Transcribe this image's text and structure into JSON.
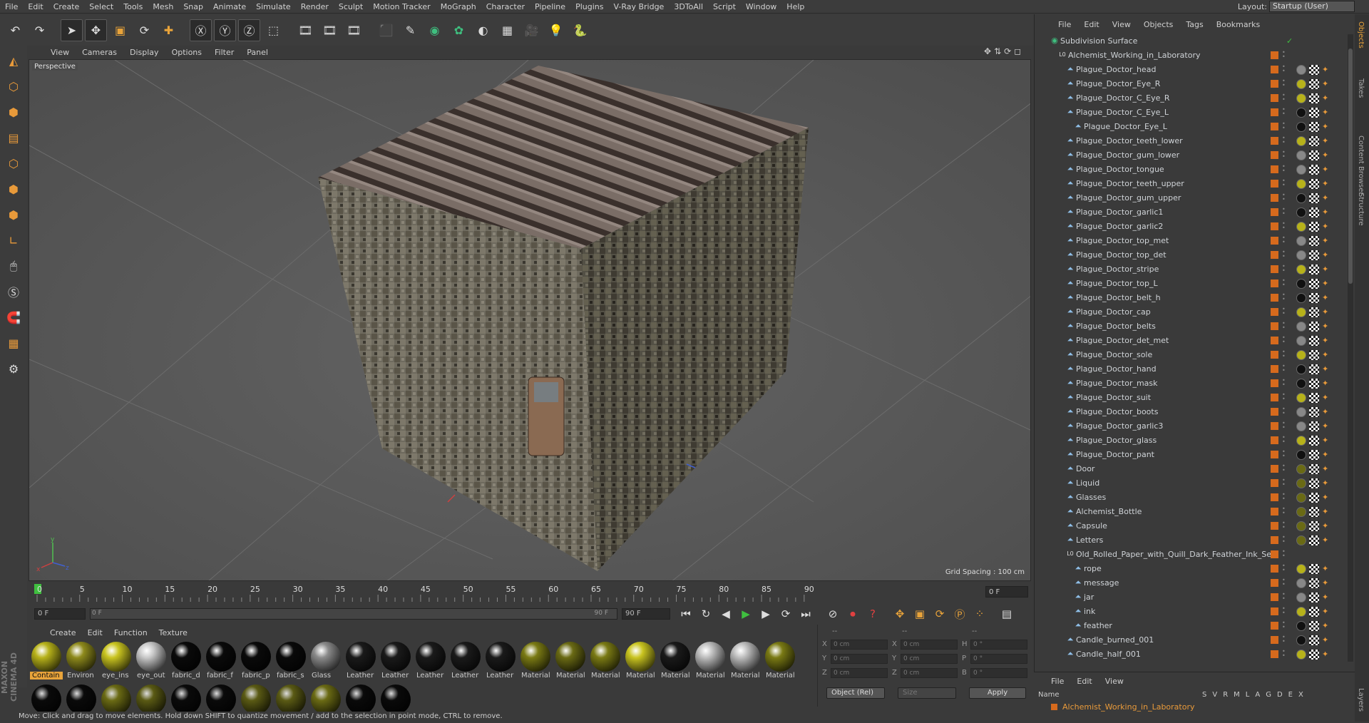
{
  "menubar": {
    "items": [
      "File",
      "Edit",
      "Create",
      "Select",
      "Tools",
      "Mesh",
      "Snap",
      "Animate",
      "Simulate",
      "Render",
      "Sculpt",
      "Motion Tracker",
      "MoGraph",
      "Character",
      "Pipeline",
      "Plugins",
      "V-Ray Bridge",
      "3DToAll",
      "Script",
      "Window",
      "Help"
    ],
    "layout_label": "Layout:",
    "layout_value": "Startup (User)"
  },
  "toolbar": {
    "icons": [
      "undo-icon",
      "redo-icon",
      "select-arrow-icon",
      "move-icon",
      "scale-icon",
      "rotate-icon",
      "add-object-icon",
      "x-axis-icon",
      "y-axis-icon",
      "z-axis-icon",
      "coordinate-system-icon",
      "render-view-icon",
      "render-picture-viewer-icon",
      "render-settings-icon",
      "cube-primitive-icon",
      "pen-spline-icon",
      "subdivision-icon",
      "array-icon",
      "deformer-icon",
      "floor-icon",
      "camera-icon",
      "light-icon",
      "python-icon"
    ],
    "glyphs": [
      "↶",
      "↷",
      "➤",
      "✥",
      "▣",
      "⟳",
      "✚",
      "Ⓧ",
      "Ⓨ",
      "Ⓩ",
      "⬚",
      "🎞",
      "🎞",
      "🎞",
      "⬛",
      "✎",
      "◉",
      "✿",
      "◐",
      "▦",
      "🎥",
      "💡",
      "🐍"
    ]
  },
  "left_tools": {
    "icons": [
      "make-editable-icon",
      "model-mode-icon",
      "texture-mode-icon",
      "workplane-icon",
      "points-mode-icon",
      "edges-mode-icon",
      "polygons-mode-icon",
      "axis-icon",
      "tweak-icon",
      "solo-icon",
      "magnet-icon",
      "snap-icon",
      "lock-workplane-icon"
    ],
    "glyphs": [
      "◭",
      "⬡",
      "⬢",
      "▤",
      "⬡",
      "⬢",
      "⬢",
      "∟",
      "🖱",
      "Ⓢ",
      "🧲",
      "▦",
      "⚙"
    ]
  },
  "viewport": {
    "menu": [
      "View",
      "Cameras",
      "Display",
      "Options",
      "Filter",
      "Panel"
    ],
    "label": "Perspective",
    "grid_spacing": "Grid Spacing : 100 cm"
  },
  "timeline": {
    "ticks": [
      "0",
      "5",
      "10",
      "15",
      "20",
      "25",
      "30",
      "35",
      "40",
      "45",
      "50",
      "55",
      "60",
      "65",
      "70",
      "75",
      "80",
      "85",
      "90"
    ],
    "current_frame": "0 F"
  },
  "controls": {
    "start": "0 F",
    "range_start": "0 F",
    "range_end": "90 F",
    "end": "90 F",
    "transport_icons": [
      "goto-start-icon",
      "loop-icon",
      "prev-frame-icon",
      "play-icon",
      "next-frame-icon",
      "record-loop-icon",
      "goto-end-icon",
      "keyframe-off-icon",
      "record-icon",
      "autokey-icon",
      "move-key-icon",
      "scale-key-icon",
      "rotate-key-icon",
      "param-key-icon",
      "pla-key-icon",
      "timeline-icon"
    ],
    "transport_glyphs": [
      "⏮",
      "↻",
      "◀",
      "▶",
      "▶",
      "⟳",
      "⏭",
      "⊘",
      "⏺",
      "?",
      "✥",
      "▣",
      "⟳",
      "Ⓟ",
      "⁘",
      "▤"
    ]
  },
  "material_menu": [
    "Create",
    "Edit",
    "Function",
    "Texture"
  ],
  "materials": [
    {
      "name": "Contain",
      "color": "#b7b21a",
      "selected": true
    },
    {
      "name": "Environ",
      "color": "#8e8a1c"
    },
    {
      "name": "eye_ins",
      "color": "#c9c420"
    },
    {
      "name": "eye_out",
      "color": "#c8c8c8"
    },
    {
      "name": "fabric_d",
      "color": "#0a0a0a"
    },
    {
      "name": "fabric_f",
      "color": "#0a0a0a"
    },
    {
      "name": "fabric_p",
      "color": "#0a0a0a"
    },
    {
      "name": "fabric_s",
      "color": "#0a0a0a"
    },
    {
      "name": "Glass",
      "color": "#8a8a8a"
    },
    {
      "name": "Leather",
      "color": "#1a1a1a"
    },
    {
      "name": "Leather",
      "color": "#1a1a1a"
    },
    {
      "name": "Leather",
      "color": "#1a1a1a"
    },
    {
      "name": "Leather",
      "color": "#1a1a1a"
    },
    {
      "name": "Leather",
      "color": "#1a1a1a"
    },
    {
      "name": "Material",
      "color": "#7a7a14"
    },
    {
      "name": "Material",
      "color": "#6a6a14"
    },
    {
      "name": "Material",
      "color": "#7a7a14"
    },
    {
      "name": "Material",
      "color": "#c9c420"
    },
    {
      "name": "Material",
      "color": "#1a1a1a"
    },
    {
      "name": "Material",
      "color": "#bdbdbd"
    },
    {
      "name": "Material",
      "color": "#bdbdbd"
    },
    {
      "name": "Material",
      "color": "#7a7a14"
    }
  ],
  "materials_row2": [
    "#0a0a0a",
    "#0a0a0a",
    "#6a6a14",
    "#5a5a14",
    "#0a0a0a",
    "#0a0a0a",
    "#5a5a14",
    "#5a5a14",
    "#6a6a14",
    "#0a0a0a",
    "#0a0a0a"
  ],
  "attributes": {
    "header": [
      "--",
      "--",
      "--"
    ],
    "rows": [
      {
        "a": "X",
        "av": "0 cm",
        "b": "X",
        "bv": "0 cm",
        "c": "H",
        "cv": "0 °"
      },
      {
        "a": "Y",
        "av": "0 cm",
        "b": "Y",
        "bv": "0 cm",
        "c": "P",
        "cv": "0 °"
      },
      {
        "a": "Z",
        "av": "0 cm",
        "b": "Z",
        "bv": "0 cm",
        "c": "B",
        "cv": "0 °"
      }
    ],
    "mode": "Object (Rel)",
    "size": "Size",
    "apply": "Apply"
  },
  "status": "Move: Click and drag to move elements. Hold down SHIFT to quantize movement / add to the selection in point mode, CTRL to remove.",
  "objects": {
    "menu": [
      "File",
      "Edit",
      "View",
      "Objects",
      "Tags",
      "Bookmarks"
    ],
    "rows": [
      {
        "name": "Subdivision Surface",
        "indent": 0,
        "kind": "sds"
      },
      {
        "name": "Alchemist_Working_in_Laboratory",
        "indent": 1,
        "kind": "null"
      },
      {
        "name": "Plague_Doctor_head",
        "indent": 2,
        "kind": "poly"
      },
      {
        "name": "Plague_Doctor_Eye_R",
        "indent": 2,
        "kind": "poly"
      },
      {
        "name": "Plague_Doctor_C_Eye_R",
        "indent": 2,
        "kind": "poly"
      },
      {
        "name": "Plague_Doctor_C_Eye_L",
        "indent": 2,
        "kind": "poly"
      },
      {
        "name": "Plague_Doctor_Eye_L",
        "indent": 3,
        "kind": "poly"
      },
      {
        "name": "Plague_Doctor_teeth_lower",
        "indent": 2,
        "kind": "poly"
      },
      {
        "name": "Plague_Doctor_gum_lower",
        "indent": 2,
        "kind": "poly"
      },
      {
        "name": "Plague_Doctor_tongue",
        "indent": 2,
        "kind": "poly"
      },
      {
        "name": "Plague_Doctor_teeth_upper",
        "indent": 2,
        "kind": "poly"
      },
      {
        "name": "Plague_Doctor_gum_upper",
        "indent": 2,
        "kind": "poly"
      },
      {
        "name": "Plague_Doctor_garlic1",
        "indent": 2,
        "kind": "poly"
      },
      {
        "name": "Plague_Doctor_garlic2",
        "indent": 2,
        "kind": "poly"
      },
      {
        "name": "Plague_Doctor_top_met",
        "indent": 2,
        "kind": "poly"
      },
      {
        "name": "Plague_Doctor_top_det",
        "indent": 2,
        "kind": "poly"
      },
      {
        "name": "Plague_Doctor_stripe",
        "indent": 2,
        "kind": "poly"
      },
      {
        "name": "Plague_Doctor_top_L",
        "indent": 2,
        "kind": "poly"
      },
      {
        "name": "Plague_Doctor_belt_h",
        "indent": 2,
        "kind": "poly"
      },
      {
        "name": "Plague_Doctor_cap",
        "indent": 2,
        "kind": "poly"
      },
      {
        "name": "Plague_Doctor_belts",
        "indent": 2,
        "kind": "poly"
      },
      {
        "name": "Plague_Doctor_det_met",
        "indent": 2,
        "kind": "poly"
      },
      {
        "name": "Plague_Doctor_sole",
        "indent": 2,
        "kind": "poly"
      },
      {
        "name": "Plague_Doctor_hand",
        "indent": 2,
        "kind": "poly"
      },
      {
        "name": "Plague_Doctor_mask",
        "indent": 2,
        "kind": "poly"
      },
      {
        "name": "Plague_Doctor_suit",
        "indent": 2,
        "kind": "poly"
      },
      {
        "name": "Plague_Doctor_boots",
        "indent": 2,
        "kind": "poly"
      },
      {
        "name": "Plague_Doctor_garlic3",
        "indent": 2,
        "kind": "poly"
      },
      {
        "name": "Plague_Doctor_glass",
        "indent": 2,
        "kind": "poly"
      },
      {
        "name": "Plague_Doctor_pant",
        "indent": 2,
        "kind": "poly"
      },
      {
        "name": "Door",
        "indent": 2,
        "kind": "poly"
      },
      {
        "name": "Liquid",
        "indent": 2,
        "kind": "poly"
      },
      {
        "name": "Glasses",
        "indent": 2,
        "kind": "poly"
      },
      {
        "name": "Alchemist_Bottle",
        "indent": 2,
        "kind": "poly"
      },
      {
        "name": "Capsule",
        "indent": 2,
        "kind": "poly"
      },
      {
        "name": "Letters",
        "indent": 2,
        "kind": "poly"
      },
      {
        "name": "Old_Rolled_Paper_with_Quill_Dark_Feather_Ink_Set",
        "indent": 2,
        "kind": "null"
      },
      {
        "name": "rope",
        "indent": 3,
        "kind": "poly"
      },
      {
        "name": "message",
        "indent": 3,
        "kind": "poly"
      },
      {
        "name": "jar",
        "indent": 3,
        "kind": "poly"
      },
      {
        "name": "ink",
        "indent": 3,
        "kind": "poly"
      },
      {
        "name": "feather",
        "indent": 3,
        "kind": "poly"
      },
      {
        "name": "Candle_burned_001",
        "indent": 2,
        "kind": "poly"
      },
      {
        "name": "Candle_half_001",
        "indent": 2,
        "kind": "poly"
      }
    ]
  },
  "side_tabs": [
    "Objects",
    "Takes",
    "Content Browser",
    "Structure"
  ],
  "layers": {
    "menu": [
      "File",
      "Edit",
      "View"
    ],
    "name_header": "Name",
    "cols": [
      "S",
      "V",
      "R",
      "M",
      "L",
      "A",
      "G",
      "D",
      "E",
      "X"
    ],
    "item": "Alchemist_Working_in_Laboratory",
    "side_tab": "Layers"
  },
  "branding": "MAXON CINEMA 4D"
}
